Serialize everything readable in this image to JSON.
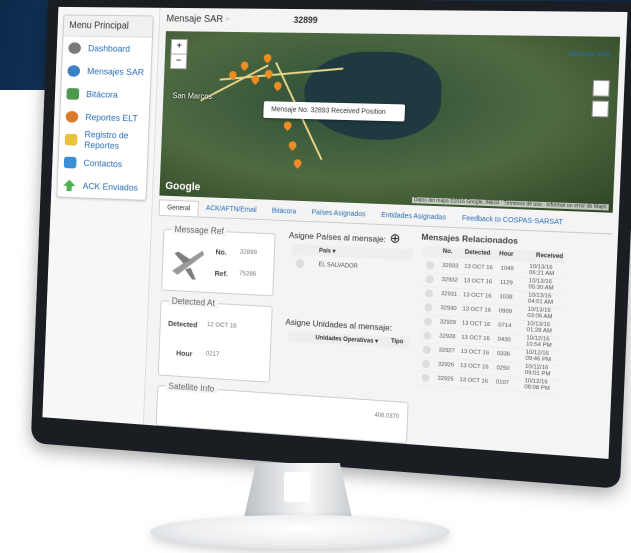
{
  "sidebar": {
    "title": "Menu Principal",
    "items": [
      {
        "label": "Dashboard",
        "icon": "dashboard-icon",
        "color": "#7a7a7a"
      },
      {
        "label": "Mensajes SAR",
        "icon": "satellite-icon",
        "color": "#3d7fc8"
      },
      {
        "label": "Bitácora",
        "icon": "map-book-icon",
        "color": "#4d9a4f"
      },
      {
        "label": "Reportes ELT",
        "icon": "person-icon",
        "color": "#d97a2b"
      },
      {
        "label": "Registro de Reportes",
        "icon": "folder-icon",
        "color": "#e8c23b"
      },
      {
        "label": "Contactos",
        "icon": "contacts-icon",
        "color": "#3a8fd9"
      },
      {
        "label": "ACK Enviados",
        "icon": "arrow-up-icon",
        "color": "#4caf50"
      }
    ]
  },
  "header": {
    "title": "Mensaje SAR",
    "message_number": "32899"
  },
  "map": {
    "popup_text": "Mensaje No. 32893 Received Position",
    "link": "Mensaje SAR",
    "labels": [
      "San Marcos",
      "Google"
    ],
    "zoom_in": "+",
    "zoom_out": "−",
    "attribution": "Datos del mapa ©2016 Google, INEGI · Términos de uso · Informar un error de Maps"
  },
  "tabs": [
    "General",
    "ACK/AFTN/Email",
    "Bitácora",
    "Países Asignados",
    "Entidades Asignadas",
    "Feedback to COSPAS-SARSAT"
  ],
  "message_ref": {
    "title": "Message Ref",
    "no_label": "No.",
    "no_value": "32899",
    "ref_label": "Ref.",
    "ref_value": "75286"
  },
  "detected": {
    "title": "Detected At",
    "detected_label": "Detected",
    "detected_value": "12 OCT 16",
    "hour_label": "Hour",
    "hour_value": "0217"
  },
  "satellite": {
    "title": "Satellite Info",
    "value": "406.0370"
  },
  "countries": {
    "title": "Asigne Países al mensaje:",
    "col_header": "País ▾",
    "rows": [
      "EL SALVADOR"
    ]
  },
  "units": {
    "title": "Asigne Unidades al mensaje:",
    "col_header": "Unidades Operativas ▾",
    "col_type": "Tipo"
  },
  "related": {
    "title": "Mensajes Relacionados",
    "headers": [
      "No.",
      "Detected",
      "Hour",
      "Received"
    ],
    "rows": [
      {
        "no": "32933",
        "detected": "13 OCT 16",
        "hour": "1049",
        "received": "10/13/16 06:21 AM"
      },
      {
        "no": "32932",
        "detected": "13 OCT 16",
        "hour": "1129",
        "received": "10/13/16 05:30 AM"
      },
      {
        "no": "32931",
        "detected": "13 OCT 16",
        "hour": "1038",
        "received": "10/13/16 04:51 AM"
      },
      {
        "no": "32930",
        "detected": "13 OCT 16",
        "hour": "0909",
        "received": "10/13/16 03:06 AM"
      },
      {
        "no": "32929",
        "detected": "13 OCT 16",
        "hour": "0714",
        "received": "10/13/16 01:28 AM"
      },
      {
        "no": "32928",
        "detected": "13 OCT 16",
        "hour": "0430",
        "received": "10/12/16 10:54 PM"
      },
      {
        "no": "32927",
        "detected": "13 OCT 16",
        "hour": "0336",
        "received": "10/12/16 09:46 PM"
      },
      {
        "no": "32926",
        "detected": "13 OCT 16",
        "hour": "0250",
        "received": "10/12/16 09:01 PM"
      },
      {
        "no": "32925",
        "detected": "13 OCT 16",
        "hour": "0107",
        "received": "10/12/16 08:08 PM"
      }
    ]
  },
  "colors": {
    "accent": "#2a6db5",
    "pin": "#ef8c22",
    "road": "#e8d58a"
  }
}
